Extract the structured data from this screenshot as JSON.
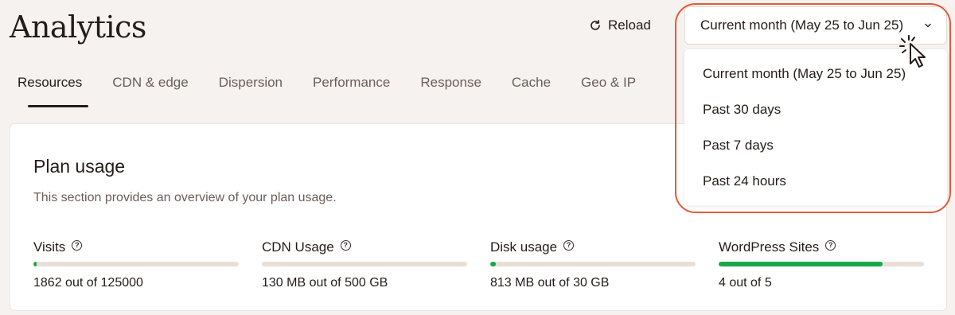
{
  "header": {
    "title": "Analytics",
    "reload_label": "Reload"
  },
  "tabs": [
    {
      "label": "Resources",
      "active": true
    },
    {
      "label": "CDN & edge"
    },
    {
      "label": "Dispersion"
    },
    {
      "label": "Performance"
    },
    {
      "label": "Response"
    },
    {
      "label": "Cache"
    },
    {
      "label": "Geo & IP"
    }
  ],
  "date_range": {
    "selected": "Current month (May 25 to Jun 25)",
    "options": [
      "Current month (May 25 to Jun 25)",
      "Past 30 days",
      "Past 7 days",
      "Past 24 hours"
    ]
  },
  "plan_usage": {
    "title": "Plan usage",
    "description": "This section provides an overview of your plan usage.",
    "metrics": [
      {
        "label": "Visits",
        "value": "1862 out of 125000",
        "fraction": 0.015
      },
      {
        "label": "CDN Usage",
        "value": "130 MB out of 500 GB",
        "fraction": 0.0
      },
      {
        "label": "Disk usage",
        "value": "813 MB out of 30 GB",
        "fraction": 0.027
      },
      {
        "label": "WordPress Sites",
        "value": "4 out of 5",
        "fraction": 0.8
      }
    ]
  },
  "colors": {
    "accent_highlight": "#e25a3b",
    "progress_fill": "#18a84a",
    "progress_track": "#eadfd7"
  },
  "icons": {
    "reload": "reload-icon",
    "help": "question-circle-icon",
    "chevron": "chevron-down-icon",
    "cursor": "pointer-cursor-icon"
  }
}
